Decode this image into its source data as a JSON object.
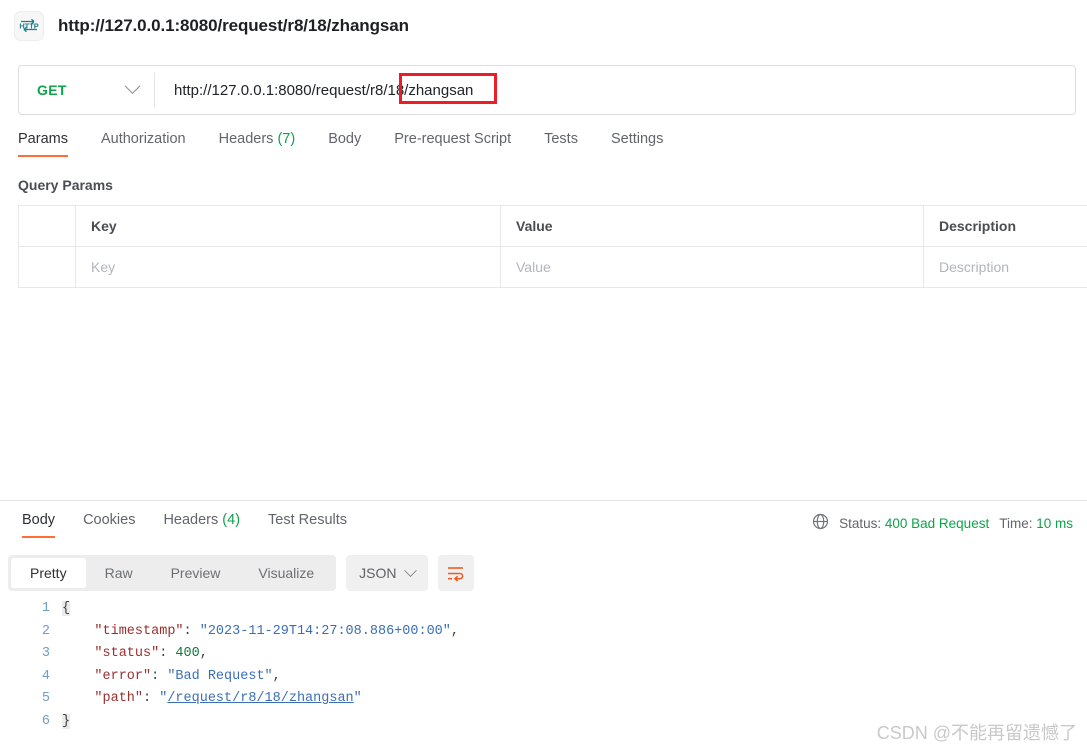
{
  "titlebar": {
    "icon": "http-icon",
    "url": "http://127.0.0.1:8080/request/r8/18/zhangsan"
  },
  "request_bar": {
    "method": "GET",
    "method_chevron": "chevron-down-icon",
    "url": "http://127.0.0.1:8080/request/r8/18/zhangsan",
    "annotation_color": "#ee1c25"
  },
  "request_tabs": [
    {
      "label": "Params",
      "active": true
    },
    {
      "label": "Authorization",
      "active": false
    },
    {
      "label": "Headers",
      "count": "(7)",
      "active": false
    },
    {
      "label": "Body",
      "active": false
    },
    {
      "label": "Pre-request Script",
      "active": false
    },
    {
      "label": "Tests",
      "active": false
    },
    {
      "label": "Settings",
      "active": false
    }
  ],
  "query_params": {
    "section_label": "Query Params",
    "headers": [
      "",
      "Key",
      "Value",
      "Description"
    ],
    "rows": [
      {
        "key": "Key",
        "value": "Value",
        "description": "Description"
      }
    ]
  },
  "response_tabs": [
    {
      "label": "Body",
      "active": true
    },
    {
      "label": "Cookies",
      "active": false
    },
    {
      "label": "Headers",
      "count": "(4)",
      "active": false
    },
    {
      "label": "Test Results",
      "active": false
    }
  ],
  "response_meta": {
    "globe_icon": "globe-icon",
    "status_label": "Status:",
    "status_value": "400 Bad Request",
    "time_label": "Time:",
    "time_value": "10 ms",
    "accent_color": "#0ea34a"
  },
  "body_toolbar": {
    "views": [
      {
        "label": "Pretty",
        "active": true
      },
      {
        "label": "Raw",
        "active": false
      },
      {
        "label": "Preview",
        "active": false
      },
      {
        "label": "Visualize",
        "active": false
      }
    ],
    "format": "JSON",
    "format_chevron": "chevron-down-icon",
    "wrap_button": "word-wrap-icon"
  },
  "response_body": {
    "language": "json",
    "line_numbers": [
      "1",
      "2",
      "3",
      "4",
      "5",
      "6"
    ],
    "lines": [
      {
        "indent": 0,
        "tokens": [
          {
            "t": "brace",
            "v": "{"
          }
        ]
      },
      {
        "indent": 4,
        "tokens": [
          {
            "t": "key",
            "v": "\"timestamp\""
          },
          {
            "t": "punct",
            "v": ": "
          },
          {
            "t": "str",
            "v": "\"2023-11-29T14:27:08.886+00:00\""
          },
          {
            "t": "punct",
            "v": ","
          }
        ]
      },
      {
        "indent": 4,
        "tokens": [
          {
            "t": "key",
            "v": "\"status\""
          },
          {
            "t": "punct",
            "v": ": "
          },
          {
            "t": "num",
            "v": "400"
          },
          {
            "t": "punct",
            "v": ","
          }
        ]
      },
      {
        "indent": 4,
        "tokens": [
          {
            "t": "key",
            "v": "\"error\""
          },
          {
            "t": "punct",
            "v": ": "
          },
          {
            "t": "str",
            "v": "\"Bad Request\""
          },
          {
            "t": "punct",
            "v": ","
          }
        ]
      },
      {
        "indent": 4,
        "tokens": [
          {
            "t": "key",
            "v": "\"path\""
          },
          {
            "t": "punct",
            "v": ": "
          },
          {
            "t": "str",
            "v": "\""
          },
          {
            "t": "link",
            "v": "/request/r8/18/zhangsan"
          },
          {
            "t": "str",
            "v": "\""
          }
        ]
      },
      {
        "indent": 0,
        "tokens": [
          {
            "t": "brace",
            "v": "}"
          }
        ]
      }
    ]
  },
  "watermark": "CSDN @不能再留遗憾了"
}
